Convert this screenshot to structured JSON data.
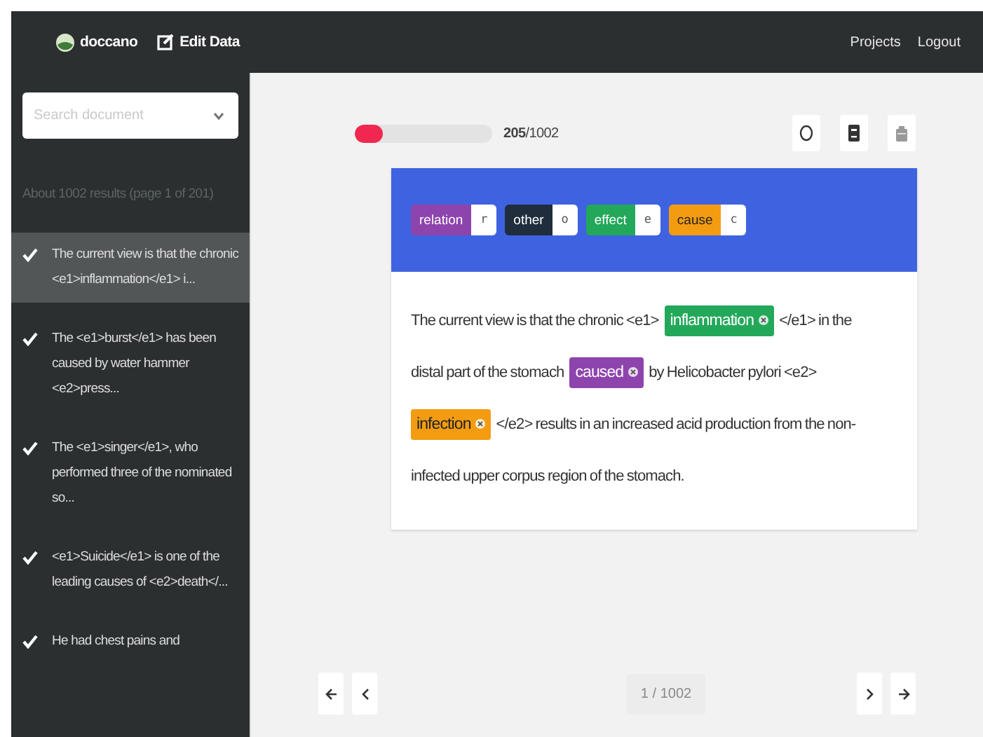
{
  "navbar": {
    "brand": "doccano",
    "edit_link": "Edit Data",
    "links": [
      "Projects",
      "Logout"
    ]
  },
  "sidebar": {
    "search": {
      "placeholder": "Search document"
    },
    "summary": "About 1002 results (page 1 of 201)",
    "items": [
      {
        "text": "The current view is that the chronic <e1>inflammation</e1> i...",
        "selected": true,
        "checked": true
      },
      {
        "text": "The <e1>burst</e1> has been caused by water hammer <e2>press...",
        "selected": false,
        "checked": true
      },
      {
        "text": "The <e1>singer</e1>, who performed three of the nominated so...",
        "selected": false,
        "checked": true
      },
      {
        "text": "<e1>Suicide</e1> is one of the leading causes of <e2>death</...",
        "selected": false,
        "checked": true
      },
      {
        "text": "He had chest pains and",
        "selected": false,
        "checked": true
      }
    ]
  },
  "progress": {
    "level": 0.2,
    "done": "205",
    "total": "/1002"
  },
  "labels": [
    {
      "name": "relation",
      "key": "r",
      "color": "#8e44ad"
    },
    {
      "name": "other",
      "key": "o",
      "color": "#1f2d3d"
    },
    {
      "name": "effect",
      "key": "e",
      "color": "#23a85a"
    },
    {
      "name": "cause",
      "key": "c",
      "color": "#f39c12"
    }
  ],
  "document": [
    [
      {
        "kind": "text",
        "text": "The current view is that the chronic <e1>"
      },
      {
        "kind": "entity",
        "text": "inflammation",
        "color": "#23a85a"
      },
      {
        "kind": "text",
        "text": "</e1> in the"
      }
    ],
    [
      {
        "kind": "text",
        "text": "distal part of the stomach"
      },
      {
        "kind": "entity",
        "text": "caused",
        "color": "#8e44ad"
      },
      {
        "kind": "text",
        "text": "by Helicobacter pylori <e2>"
      }
    ],
    [
      {
        "kind": "entity",
        "text": "infection",
        "color": "#f39c12"
      },
      {
        "kind": "text",
        "text": "</e2> results in an increased acid production from the non-"
      }
    ],
    [
      {
        "kind": "text",
        "text": "infected upper corpus region of the stomach."
      }
    ]
  ],
  "pagination": {
    "page": "1 / 1002"
  }
}
